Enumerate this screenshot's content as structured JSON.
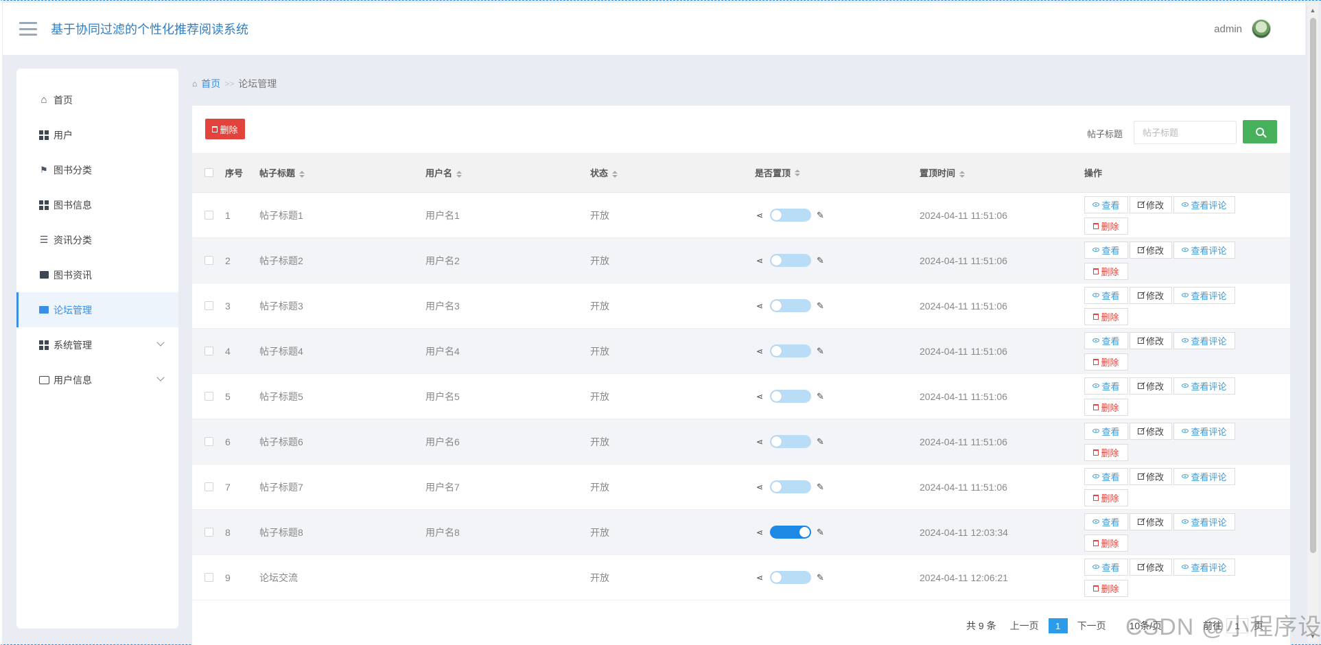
{
  "header": {
    "title": "基于协同过滤的个性化推荐阅读系统",
    "username": "admin"
  },
  "sidebar": {
    "items": [
      {
        "label": "首页",
        "icon": "home-icon"
      },
      {
        "label": "用户",
        "icon": "grid-icon"
      },
      {
        "label": "图书分类",
        "icon": "flag-icon"
      },
      {
        "label": "图书信息",
        "icon": "grid-icon"
      },
      {
        "label": "资讯分类",
        "icon": "sliders-icon"
      },
      {
        "label": "图书资讯",
        "icon": "inbox-icon"
      },
      {
        "label": "论坛管理",
        "icon": "briefcase-icon",
        "active": true
      },
      {
        "label": "系统管理",
        "icon": "grid-icon",
        "expandable": true
      },
      {
        "label": "用户信息",
        "icon": "card-icon",
        "expandable": true
      }
    ]
  },
  "breadcrumb": {
    "home": "首页",
    "separator": ">>",
    "current": "论坛管理"
  },
  "toolbar": {
    "delete_label": "删除",
    "search_label": "帖子标题",
    "search_placeholder": "帖子标题"
  },
  "table": {
    "headers": {
      "no": "序号",
      "title": "帖子标题",
      "username": "用户名",
      "status": "状态",
      "is_top": "是否置顶",
      "top_time": "置顶时间",
      "ops": "操作"
    },
    "op_labels": {
      "view": "查看",
      "edit": "修改",
      "comments": "查看评论",
      "delete": "删除"
    },
    "rows": [
      {
        "no": "1",
        "title": "帖子标题1",
        "username": "用户名1",
        "status": "开放",
        "is_top": false,
        "top_time": "2024-04-11 11:51:06"
      },
      {
        "no": "2",
        "title": "帖子标题2",
        "username": "用户名2",
        "status": "开放",
        "is_top": false,
        "top_time": "2024-04-11 11:51:06"
      },
      {
        "no": "3",
        "title": "帖子标题3",
        "username": "用户名3",
        "status": "开放",
        "is_top": false,
        "top_time": "2024-04-11 11:51:06"
      },
      {
        "no": "4",
        "title": "帖子标题4",
        "username": "用户名4",
        "status": "开放",
        "is_top": false,
        "top_time": "2024-04-11 11:51:06"
      },
      {
        "no": "5",
        "title": "帖子标题5",
        "username": "用户名5",
        "status": "开放",
        "is_top": false,
        "top_time": "2024-04-11 11:51:06"
      },
      {
        "no": "6",
        "title": "帖子标题6",
        "username": "用户名6",
        "status": "开放",
        "is_top": false,
        "top_time": "2024-04-11 11:51:06"
      },
      {
        "no": "7",
        "title": "帖子标题7",
        "username": "用户名7",
        "status": "开放",
        "is_top": false,
        "top_time": "2024-04-11 11:51:06"
      },
      {
        "no": "8",
        "title": "帖子标题8",
        "username": "用户名8",
        "status": "开放",
        "is_top": true,
        "top_time": "2024-04-11 12:03:34"
      },
      {
        "no": "9",
        "title": "论坛交流",
        "username": "",
        "status": "开放",
        "is_top": false,
        "top_time": "2024-04-11 12:06:21"
      }
    ]
  },
  "pagination": {
    "total": "共 9 条",
    "prev": "上一页",
    "current": "1",
    "next": "下一页",
    "page_size": "10条/页",
    "goto": "前往",
    "goto_value": "1",
    "unit": "页"
  },
  "watermark": "CSDN @小程序设计",
  "colors": {
    "accent": "#3a8ee6",
    "danger": "#e2443d",
    "success": "#46b05a",
    "switch_on": "#1e88e5",
    "switch_off": "#b9dcf7"
  }
}
